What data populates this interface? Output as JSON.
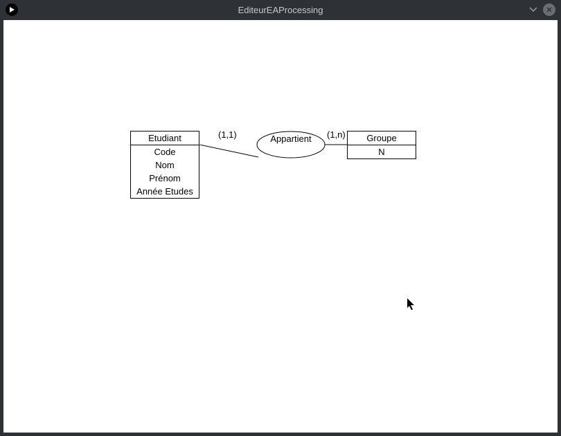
{
  "window": {
    "title": "EditeurEAProcessing"
  },
  "diagram": {
    "entities": [
      {
        "name": "Etudiant",
        "attributes": [
          "Code",
          "Nom",
          "Prénom",
          "Année Etudes"
        ]
      },
      {
        "name": "Groupe",
        "attributes": [
          "N"
        ]
      }
    ],
    "relationship": {
      "name": "Appartient",
      "cardinality_left": "(1,1)",
      "cardinality_right": "(1,n)"
    }
  }
}
